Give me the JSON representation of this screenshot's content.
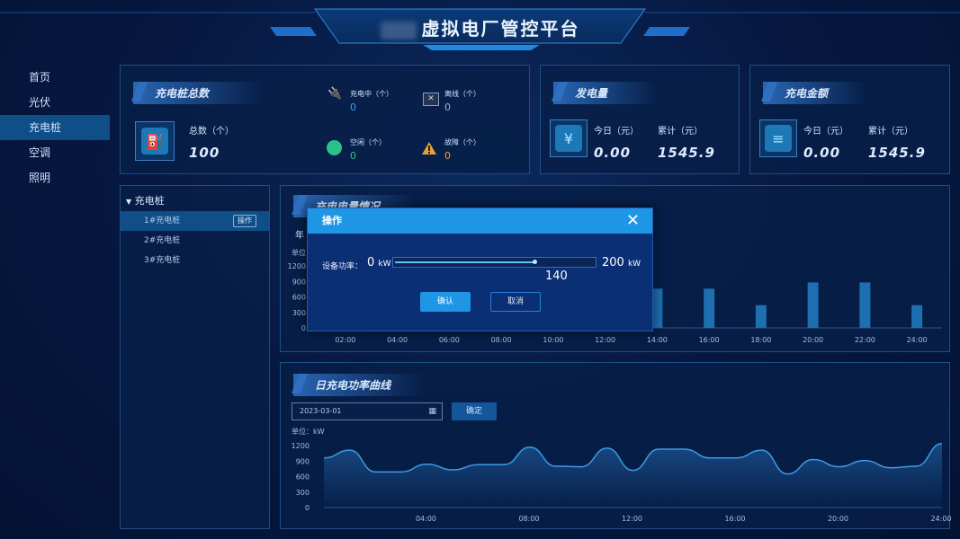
{
  "header": {
    "title": "虚拟电厂管控平台"
  },
  "nav": {
    "items": [
      "首页",
      "光伏",
      "充电桩",
      "空调",
      "照明"
    ],
    "active_index": 2
  },
  "charging_total": {
    "title": "充电桩总数",
    "total_label": "总数（个）",
    "total_value": "100",
    "charging_label": "充电中（个）",
    "charging_value": "0",
    "offline_label": "离线（个）",
    "offline_value": "0",
    "idle_label": "空闲（个）",
    "idle_value": "0",
    "fault_label": "故障（个）",
    "fault_value": "0"
  },
  "generation": {
    "title": "发电量",
    "today_label": "今日（元）",
    "today_value": "0.00",
    "total_label": "累计（元）",
    "total_value": "1545.9"
  },
  "charging_amount": {
    "title": "充电金额",
    "today_label": "今日（元）",
    "today_value": "0.00",
    "total_label": "累计（元）",
    "total_value": "1545.9"
  },
  "tree": {
    "root": "充电桩",
    "items": [
      "1#充电桩",
      "2#充电桩",
      "3#充电桩"
    ],
    "op_label": "操作"
  },
  "bar_panel": {
    "title": "充电电量情况",
    "tab_label": "年",
    "unit_label": "单位："
  },
  "line_panel": {
    "title": "日充电功率曲线",
    "date_value": "2023-03-01",
    "confirm_label": "确定",
    "unit_label": "单位：kW"
  },
  "modal": {
    "title": "操作",
    "power_label": "设备功率：",
    "min_value": "0",
    "min_unit": "kW",
    "max_value": "200",
    "max_unit": "kW",
    "current_value": "140",
    "ok_label": "确认",
    "cancel_label": "取消"
  },
  "colors": {
    "accent": "#1f95e6",
    "bar": "#1e6fb0",
    "line": "#3b9be6"
  },
  "chart_data": [
    {
      "type": "bar",
      "title": "充电电量情况",
      "categories": [
        "02:00",
        "04:00",
        "06:00",
        "08:00",
        "10:00",
        "12:00",
        "14:00",
        "16:00",
        "18:00",
        "20:00",
        "22:00",
        "24:00"
      ],
      "visible_categories": [
        "14:00",
        "16:00",
        "18:00",
        "20:00",
        "22:00",
        "24:00"
      ],
      "visible_values": [
        760,
        760,
        440,
        880,
        880,
        440
      ],
      "ylim": [
        0,
        1200
      ],
      "yticks": [
        "1200",
        "900",
        "600",
        "300",
        "0"
      ]
    },
    {
      "type": "line",
      "title": "日充电功率曲线",
      "ylabel": "单位：kW",
      "x_ticks": [
        "04:00",
        "08:00",
        "12:00",
        "16:00",
        "20:00",
        "24:00"
      ],
      "x": [
        0,
        1,
        2,
        3,
        4,
        5,
        6,
        7,
        8,
        9,
        10,
        11,
        12,
        13,
        14,
        15,
        16,
        17,
        18,
        19,
        20,
        21,
        22,
        23,
        24
      ],
      "y": [
        960,
        1110,
        690,
        690,
        840,
        730,
        830,
        830,
        1170,
        800,
        790,
        1150,
        720,
        1130,
        1130,
        960,
        960,
        1110,
        650,
        930,
        790,
        910,
        770,
        800,
        1240
      ],
      "ylim": [
        0,
        1200
      ],
      "yticks": [
        "1200",
        "900",
        "600",
        "300",
        "0"
      ]
    }
  ]
}
